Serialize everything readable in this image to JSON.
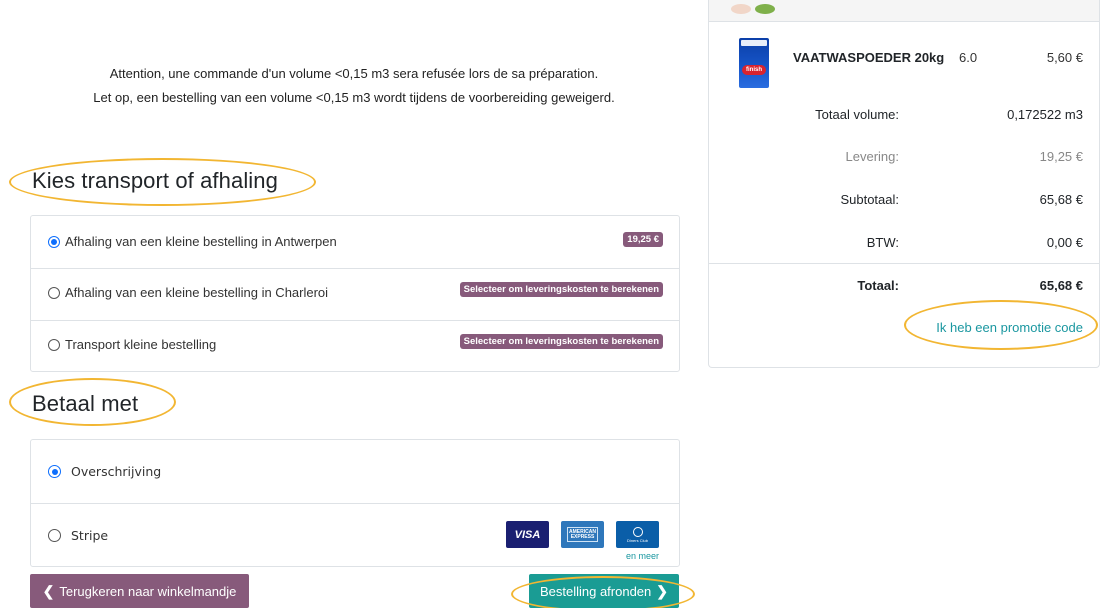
{
  "notice": {
    "fr": "Attention, une commande d'un volume <0,15 m3 sera refusée lors de sa préparation.",
    "nl": "Let op, een bestelling van een volume <0,15 m3 wordt tijdens de voorbereiding geweigerd."
  },
  "transport": {
    "title": "Kies transport of afhaling",
    "options": [
      {
        "label": "Afhaling van een kleine bestelling in Antwerpen",
        "badge": "19,25 €",
        "selected": true
      },
      {
        "label": "Afhaling van een kleine bestelling in Charleroi",
        "badge": "Selecteer om leveringskosten te berekenen",
        "selected": false
      },
      {
        "label": "Transport kleine bestelling",
        "badge": "Selecteer om leveringskosten te berekenen",
        "selected": false
      }
    ]
  },
  "payment": {
    "title": "Betaal met",
    "options": [
      {
        "label": "Overschrijving",
        "selected": true
      },
      {
        "label": "Stripe",
        "selected": false
      }
    ],
    "card_labels": {
      "visa": "VISA",
      "amex": "AMERICAN EXPRESS"
    },
    "more_label": "en meer"
  },
  "buttons": {
    "back": "Terugkeren naar winkelmandje",
    "submit": "Bestelling afronden"
  },
  "summary": {
    "product": {
      "name": "VAATWASPOEDER 20kg",
      "qty": "6.0",
      "price": "5,60 €",
      "brand": "finish"
    },
    "lines": [
      {
        "key": "Totaal volume:",
        "value": "0,172522 m3"
      },
      {
        "key": "Levering:",
        "value": "19,25 €"
      },
      {
        "key": "Subtotaal:",
        "value": "65,68 €"
      },
      {
        "key": "BTW:",
        "value": "0,00 €"
      }
    ],
    "total": {
      "key": "Totaal:",
      "value": "65,68 €"
    },
    "promo": "Ik heb een promotie code"
  },
  "colors": {
    "accent_purple": "#875a7b",
    "accent_teal": "#1a9c94",
    "link": "#1a97a0",
    "highlight": "#f2b632"
  }
}
